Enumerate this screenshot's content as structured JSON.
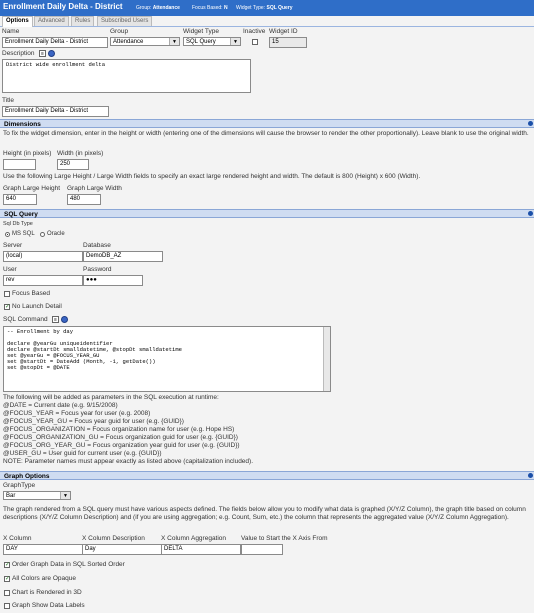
{
  "header": {
    "title": "Enrollment Daily Delta - District",
    "group_label": "Group:",
    "group_value": "Attendance",
    "focus_label": "Focus Based:",
    "focus_value": "N",
    "type_label": "Widget Type:",
    "type_value": "SQL Query"
  },
  "tabs": [
    "Options",
    "Advanced",
    "Rules",
    "Subscribed Users"
  ],
  "general": {
    "name_label": "Name",
    "name_value": "Enrollment Daily Delta - District",
    "group_label": "Group",
    "group_value": "Attendance",
    "widget_type_label": "Widget Type",
    "widget_type_value": "SQL Query",
    "inactive_label": "Inactive",
    "widget_id_label": "Widget ID",
    "widget_id_value": "15",
    "description_label": "Description",
    "description_value": "District wide enrollment delta",
    "title_label": "Title",
    "title_value": "Enrollment Daily Delta - District"
  },
  "dimensions": {
    "heading": "Dimensions",
    "help1": "To fix the widget dimension, enter in the height or width (entering one of the dimensions will cause the browser to render the other proportionally). Leave blank to use the original width.",
    "height_label": "Height (in pixels)",
    "height_value": "",
    "width_label": "Width (in pixels)",
    "width_value": "250",
    "help2": "Use the following Large Height / Large Width fields to specify an exact large rendered height and width. The default is 800 (Height) x 600 (Width).",
    "large_height_label": "Graph Large Height",
    "large_height_value": "640",
    "large_width_label": "Graph Large Width",
    "large_width_value": "480"
  },
  "sql": {
    "heading": "SQL Query",
    "dbtype_label": "Sql Db Type",
    "dbtype_options": [
      "MS SQL",
      "Oracle"
    ],
    "server_label": "Server",
    "server_value": "(local)",
    "database_label": "Database",
    "database_value": "DemoDB_AZ",
    "user_label": "User",
    "user_value": "rev",
    "password_label": "Password",
    "password_value": "●●●",
    "focus_based_label": "Focus Based",
    "no_launch_label": "No Launch Detail",
    "command_label": "SQL Command",
    "command_lines": [
      "-- Enrollment by day",
      "",
      "declare @yearGu uniqueidentifier",
      "declare @startDt smalldatetime, @stopDt smalldatetime",
      "set @yearGu = @FOCUS_YEAR_GU",
      "set @startDt = DateAdd (Month, -1, getDate())",
      "set @stopDt = @DATE"
    ],
    "params_intro": "The following will be added as parameters in the SQL execution at runtime:",
    "params": [
      "@DATE = Current date (e.g. 9/15/2008)",
      "@FOCUS_YEAR = Focus year for user (e.g. 2008)",
      "@FOCUS_YEAR_GU = Focus year guid for user (e.g. {GUID})",
      "@FOCUS_ORGANIZATION = Focus organization name for user (e.g. Hope HS)",
      "@FOCUS_ORGANIZATION_GU = Focus organization guid for user (e.g. {GUID})",
      "@FOCUS_ORG_YEAR_GU = Focus organization year guid for user (e.g. {GUID})",
      "@USER_GU = User guid for current user (e.g. {GUID})",
      "NOTE: Parameter names must appear exactly as listed above (capitalization included)."
    ]
  },
  "graph": {
    "heading": "Graph Options",
    "type_label": "GraphType",
    "type_value": "Bar",
    "help": "The graph rendered from a SQL query must have various aspects defined. The fields below allow you to modify what data is graphed (X/Y/Z Column), the graph title based on column descriptions (X/Y/Z Column Description) and (if you are using aggregation; e.g. Count, Sum, etc.) the column that represents the aggregated value (X/Y/Z Column Aggregation).",
    "xcol_label": "X Column",
    "xcol_value": "DAY",
    "xdesc_label": "X Column Description",
    "xdesc_value": "Day",
    "xagg_label": "X Column Aggregation",
    "xagg_value": "DELTA",
    "xstart_label": "Value to Start the X Axis From",
    "xstart_value": "",
    "order_label": "Order Graph Data in SQL Sorted Order",
    "opaque_label": "All Colors are Opaque",
    "3d_label": "Chart is Rendered in 3D",
    "labels_label": "Graph Show Data Labels"
  }
}
